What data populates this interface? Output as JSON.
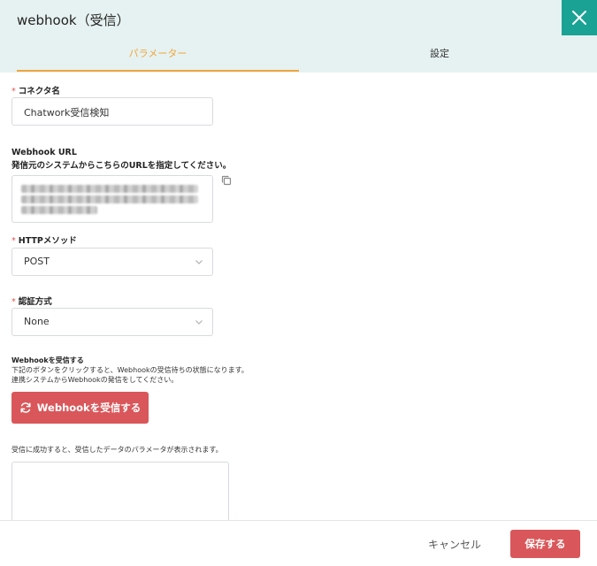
{
  "dialog": {
    "title": "webhook（受信）",
    "close_icon": "close-icon"
  },
  "tabs": [
    {
      "label": "パラメーター",
      "active": true
    },
    {
      "label": "設定",
      "active": false
    }
  ],
  "form": {
    "connector_name": {
      "label": "コネクタ名",
      "required_mark": "*",
      "value": "Chatwork受信検知"
    },
    "webhook_url": {
      "label": "Webhook URL",
      "description": "発信元のシステムからこちらのURLを指定してください。",
      "copy_icon": "copy-icon"
    },
    "http_method": {
      "label": "HTTPメソッド",
      "required_mark": "*",
      "value": "POST"
    },
    "auth_method": {
      "label": "認証方式",
      "required_mark": "*",
      "value": "None"
    },
    "receive": {
      "label": "Webhookを受信する",
      "description_1": "下記のボタンをクリックすると、Webhookの受信待ちの状態になります。",
      "description_2": "連携システムからWebhookの発信をしてください。",
      "button_label": "Webhookを受信する",
      "button_icon": "refresh-icon"
    },
    "result": {
      "description": "受信に成功すると、受信したデータのパラメータが表示されます。"
    }
  },
  "footer": {
    "cancel_label": "キャンセル",
    "save_label": "保存する"
  },
  "colors": {
    "header_bg": "#e6f2f1",
    "close_bg": "#1aa394",
    "active_tab": "#f0a53c",
    "primary_button": "#d9575a",
    "required": "#e05555"
  }
}
